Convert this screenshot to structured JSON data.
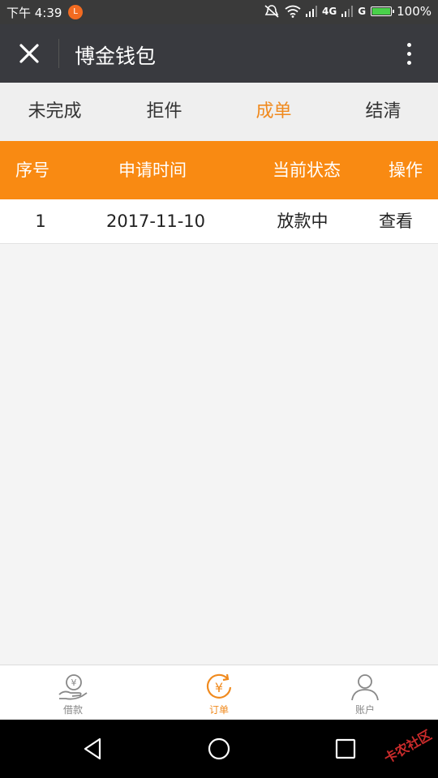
{
  "status": {
    "time": "下午 4:39",
    "notif_badge": "L",
    "network_4g": "4G",
    "network_g": "G",
    "battery": "100%"
  },
  "header": {
    "title": "博金钱包"
  },
  "tabs": [
    {
      "label": "未完成",
      "active": false
    },
    {
      "label": "拒件",
      "active": false
    },
    {
      "label": "成单",
      "active": true
    },
    {
      "label": "结清",
      "active": false
    }
  ],
  "table": {
    "columns": [
      "序号",
      "申请时间",
      "当前状态",
      "操作"
    ],
    "rows": [
      {
        "index": "1",
        "date": "2017-11-10",
        "status": "放款中",
        "action": "查看"
      }
    ]
  },
  "bottom_nav": [
    {
      "label": "借款",
      "icon": "loan-icon",
      "active": false
    },
    {
      "label": "订单",
      "icon": "order-yen-icon",
      "active": true
    },
    {
      "label": "账户",
      "icon": "account-user-icon",
      "active": false
    }
  ],
  "watermark": "卡农社区",
  "colors": {
    "accent": "#f98a12",
    "active_text": "#f08a1e",
    "titlebar": "#393a3f"
  }
}
